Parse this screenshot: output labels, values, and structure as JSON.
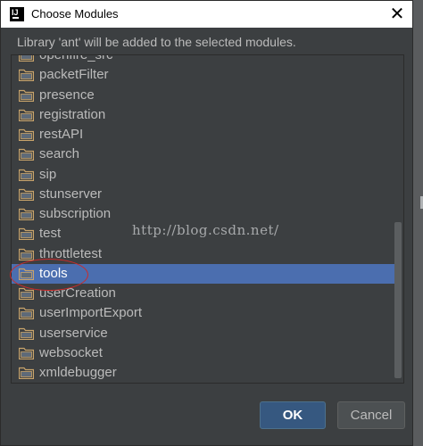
{
  "window": {
    "title": "Choose Modules",
    "close_glyph": "✕",
    "app_icon_text": "IJ"
  },
  "message": "Library 'ant' will be added to the selected modules.",
  "modules": [
    {
      "label": "openfire_src",
      "selected": false
    },
    {
      "label": "packetFilter",
      "selected": false
    },
    {
      "label": "presence",
      "selected": false
    },
    {
      "label": "registration",
      "selected": false
    },
    {
      "label": "restAPI",
      "selected": false
    },
    {
      "label": "search",
      "selected": false
    },
    {
      "label": "sip",
      "selected": false
    },
    {
      "label": "stunserver",
      "selected": false
    },
    {
      "label": "subscription",
      "selected": false
    },
    {
      "label": "test",
      "selected": false
    },
    {
      "label": "throttletest",
      "selected": false
    },
    {
      "label": "tools",
      "selected": true
    },
    {
      "label": "userCreation",
      "selected": false
    },
    {
      "label": "userImportExport",
      "selected": false
    },
    {
      "label": "userservice",
      "selected": false
    },
    {
      "label": "websocket",
      "selected": false
    },
    {
      "label": "xmldebugger",
      "selected": false
    }
  ],
  "folder_icon": "folder-icon",
  "watermark": "http://blog.csdn.net/",
  "buttons": {
    "ok": "OK",
    "cancel": "Cancel"
  },
  "colors": {
    "dialog_bg": "#3c3f41",
    "selection": "#4b6eaf",
    "text": "#bbbbbb",
    "folder": "#c9a46b",
    "annotation": "#cc2a2a"
  }
}
